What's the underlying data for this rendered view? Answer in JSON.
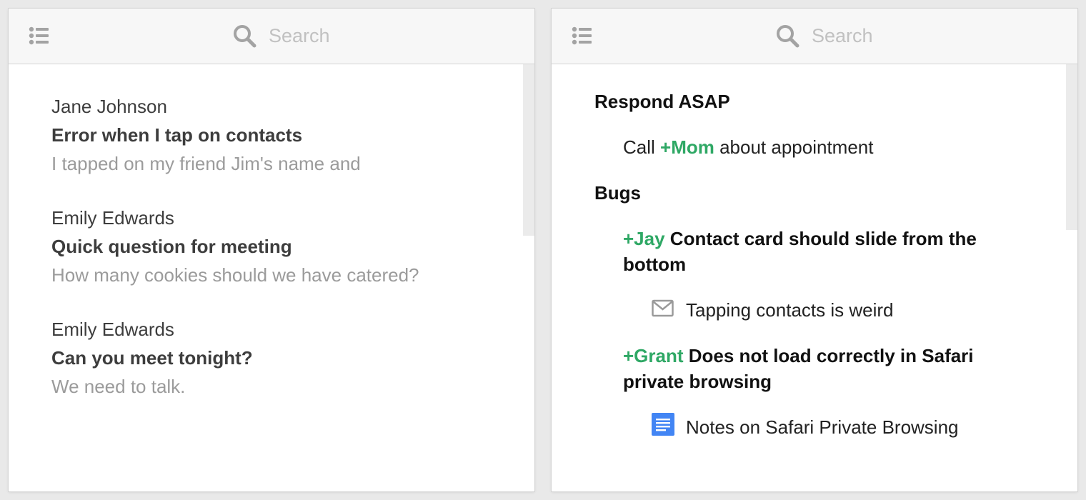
{
  "left_panel": {
    "search": {
      "placeholder": "Search"
    },
    "messages": [
      {
        "sender": "Jane Johnson",
        "subject": "Error when I tap on contacts",
        "preview": "I tapped on my friend Jim's name and"
      },
      {
        "sender": "Emily Edwards",
        "subject": "Quick question for meeting",
        "preview": "How many cookies should we have catered?"
      },
      {
        "sender": "Emily Edwards",
        "subject": "Can you meet tonight?",
        "preview": "We need to talk."
      }
    ]
  },
  "right_panel": {
    "search": {
      "placeholder": "Search"
    },
    "sections": [
      {
        "title": "Respond ASAP",
        "task": {
          "prefix": "Call ",
          "mention": "+Mom",
          "suffix": " about appointment"
        }
      },
      {
        "title": "Bugs",
        "tasks": [
          {
            "mention": "+Jay",
            "text": " Contact card should slide from the bottom",
            "attachment": {
              "icon": "envelope-icon",
              "label": "Tapping contacts is weird"
            }
          },
          {
            "mention": "+Grant",
            "text": " Does not load correctly in Safari private browsing",
            "attachment": {
              "icon": "document-icon",
              "label": "Notes on Safari Private Browsing"
            }
          }
        ]
      }
    ]
  },
  "colors": {
    "mention": "#2fa865",
    "doc_icon": "#4285f4",
    "icon_gray": "#9a9a9a",
    "header_bg": "#f7f7f7"
  }
}
